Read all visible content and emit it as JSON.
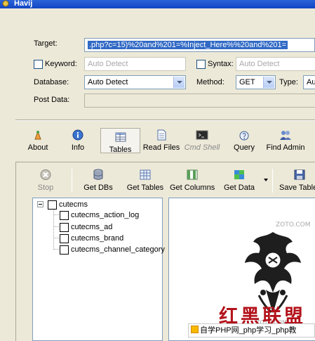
{
  "window": {
    "title": "Havij"
  },
  "form": {
    "target_label": "Target:",
    "target_value": ".php?c=15)%20and%201=%Inject_Here%%20and%201=",
    "keyword_label": "Keyword:",
    "keyword_placeholder": "Auto Detect",
    "syntax_label": "Syntax:",
    "syntax_placeholder": "Auto Detect",
    "database_label": "Database:",
    "database_value": "Auto Detect",
    "method_label": "Method:",
    "method_value": "GET",
    "type_label": "Type:",
    "type_value": "Au",
    "postdata_label": "Post Data:"
  },
  "nav": [
    {
      "label": "About",
      "icon": "about-icon"
    },
    {
      "label": "Info",
      "icon": "info-icon"
    },
    {
      "label": "Tables",
      "icon": "tables-icon",
      "active": true
    },
    {
      "label": "Read Files",
      "icon": "read-files-icon"
    },
    {
      "label": "Cmd Shell",
      "icon": "cmd-shell-icon",
      "disabled": true
    },
    {
      "label": "Query",
      "icon": "query-icon"
    },
    {
      "label": "Find Admin",
      "icon": "find-admin-icon"
    }
  ],
  "toolbar": [
    {
      "label": "Stop",
      "icon": "stop-icon",
      "disabled": true
    },
    {
      "label": "Get DBs",
      "icon": "get-dbs-icon"
    },
    {
      "label": "Get Tables",
      "icon": "get-tables-icon"
    },
    {
      "label": "Get Columns",
      "icon": "get-columns-icon"
    },
    {
      "label": "Get Data",
      "icon": "get-data-icon"
    },
    {
      "label": "Save Table",
      "icon": "save-table-icon"
    }
  ],
  "tree": {
    "database": "cutecms",
    "tables": [
      "cutecms_action_log",
      "cutecms_ad",
      "cutecms_brand",
      "cutecms_channel_category"
    ]
  },
  "watermark": {
    "site_top": "ZOTO.COM",
    "site_bottom": "ZOTO.COM",
    "logo_text": "红黑联盟",
    "banner_text": "自学PHP网_php学习_php教"
  },
  "colors": {
    "titlebar": "#2a63d8",
    "selection": "#316ac5",
    "logo_red": "#b3131b",
    "background": "#ece9d8"
  }
}
